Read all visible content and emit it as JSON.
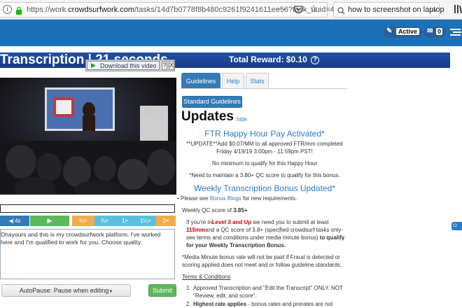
{
  "browser": {
    "url_prefix": "https://work.",
    "url_domain": "crowdsurfwork.com",
    "url_path": "/tasks/14d7b0778f8b480c9261f9241611ee56?task_uuid=4",
    "search_value": "how to screenshot on laptop"
  },
  "header": {
    "active_label": "Active",
    "mail_count": "0"
  },
  "task": {
    "title": "Transcription | 21 seconds",
    "total_reward": "Total Reward: $0.10",
    "download_label": "Download this video",
    "download_help": "?",
    "download_close": "X"
  },
  "controls": {
    "rewind": "4s",
    "speeds": [
      "½×",
      "¾×",
      "1×",
      "1¼×",
      "2×"
    ]
  },
  "editor": {
    "text": "Dhayours and this is my crowdsurfwork platform. I've worked here and I'm qualified to work for you. Choose quality."
  },
  "actions": {
    "autopause": "AutoPause: Pause when editing",
    "submit": "Submit"
  },
  "tabs": [
    "Guidelines",
    "Help",
    "Stats"
  ],
  "guidelines": {
    "standard_button": "Standard Guidelines",
    "heading": "Updates",
    "hide": "hide",
    "happy_hour_title": "FTR Happy Hour Pay Activated*",
    "happy_hour_line1": "**UPDATE**Add $0.07/MM to all approved FTR/mm completed",
    "happy_hour_line2": "Friday 4/19/19 3:00pm - 11:59pm PST!",
    "no_minimum": "No minimum to qualify for this Happy Hour",
    "qc_needed": "*Need to maintain a 3.80+ QC score to qualify for this bonus.",
    "weekly_title": "Weekly Transcription Bonus Updated*",
    "bullet_pre": "Please see ",
    "bullet_link": "Bonus Blogs",
    "bullet_post": " for new requirements.",
    "weekly_qc_label": "Weekly QC score of ",
    "weekly_qc_value": "3.85+",
    "level_pre": "If you're in",
    "level_red": "Level 3 and Up",
    "level_mid": " we need you to submit at least ",
    "level_mm": "115mm",
    "level_rest": "and a QC score of 3.8+ (specified crowdsurf tasks only- see terms and conditions under media minute bonus) ",
    "level_bold": "to qualify for your Weekly Transcription Bonus.",
    "media_minute_note": "*Media Minute bonus rate will not be paid if Fraud is detected or scoring applied does not meet and or follow guideline standards.",
    "terms_heading": "Terms & Conditions",
    "terms_1": "Approved Transcription and \"Edit the Transcript\" ONLY. NOT \"Review, edit, and score\".",
    "terms_2_bold": "Highest rate applies",
    "terms_2_rest": " - bonus rates and prorates are not"
  },
  "side_tab": "Cr"
}
